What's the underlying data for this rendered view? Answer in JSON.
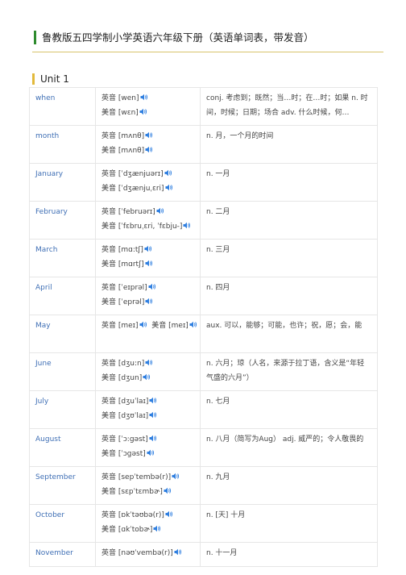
{
  "doc_title": "鲁教版五四学制小学英语六年级下册（英语单词表，带发音）",
  "unit": "Unit 1",
  "colors": {
    "title_bar": "#2e8b2e",
    "unit_bar": "#e2b93b",
    "rule": "#d8c36a",
    "word": "#3f6fb5",
    "speaker": "#2f7fe0"
  },
  "speaker_icon": "speaker-icon",
  "rows": [
    {
      "word": "when",
      "uk": "英音 [wen]",
      "us": "美音 [wɛn]",
      "meaning": "conj. 考虑到；既然；当…时；在…时；如果 n. 时间，时候；日期；场合 adv. 什么时候，何…"
    },
    {
      "word": "month",
      "uk": "英音 [mʌnθ]",
      "us": "美音 [mʌnθ]",
      "meaning": "n. 月，一个月的时间"
    },
    {
      "word": "January",
      "uk": "英音 [ˈdʒænjuərɪ]",
      "us": "美音 [ˈdʒænjuˌɛri]",
      "meaning": "n. 一月"
    },
    {
      "word": "February",
      "uk": "英音 [ˈfebruərɪ]",
      "us": "美音 [ˈfɛbruˌɛri, ˈfɛbju-]",
      "meaning": "n. 二月"
    },
    {
      "word": "March",
      "uk": "英音 [mɑ:tʃ]",
      "us": "美音 [mɑrtʃ]",
      "meaning": "n. 三月"
    },
    {
      "word": "April",
      "uk": "英音 [ˈeɪprəl]",
      "us": "美音 [ˈeprəl]",
      "meaning": "n. 四月"
    },
    {
      "word": "May",
      "uk": "英音 [meɪ]",
      "us": "美音 [meɪ]",
      "meaning": "aux. 可以，能够；可能，也许；祝，愿；会，能"
    },
    {
      "word": "June",
      "uk": "英音 [dʒu:n]",
      "us": "美音 [dʒun]",
      "meaning": "n. 六月；琼（人名，来源于拉丁语，含义是“年轻气盛的六月”）"
    },
    {
      "word": "July",
      "uk": "英音 [dʒuˈlaɪ]",
      "us": "美音 [dʒʊˈlaɪ]",
      "meaning": "n. 七月"
    },
    {
      "word": "August",
      "uk": "英音 [ˈɔ:gəst]",
      "us": "美音 [ˈɔgəst]",
      "meaning": "n. 八月（简写为Aug） adj. 威严的；令人敬畏的"
    },
    {
      "word": "September",
      "uk": "英音 [sepˈtembə(r)]",
      "us": "美音 [sɛpˈtɛmbɚ]",
      "meaning": "n. 九月"
    },
    {
      "word": "October",
      "uk": "英音 [ɒkˈtəʊbə(r)]",
      "us": "美音 [ɑkˈtobɚ]",
      "meaning": "n. [天] 十月"
    },
    {
      "word": "November",
      "uk": "英音 [nəʊˈvembə(r)]",
      "us": "",
      "meaning": "n. 十一月"
    }
  ]
}
